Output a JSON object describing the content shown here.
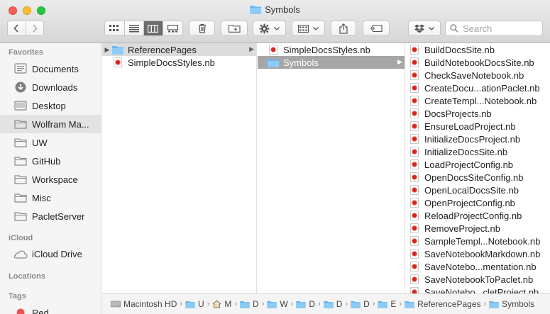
{
  "window": {
    "title": "Symbols"
  },
  "toolbar": {
    "search_placeholder": "Search",
    "view_modes": [
      "icon-view",
      "list-view",
      "column-view",
      "gallery-view"
    ],
    "active_view": "column-view"
  },
  "sidebar": {
    "sections": [
      {
        "header": "Favorites",
        "items": [
          {
            "label": "Documents",
            "icon": "documents-icon"
          },
          {
            "label": "Downloads",
            "icon": "downloads-icon"
          },
          {
            "label": "Desktop",
            "icon": "desktop-icon"
          },
          {
            "label": "Wolfram Ma...",
            "icon": "folder-icon",
            "selected": true
          },
          {
            "label": "UW",
            "icon": "folder-icon"
          },
          {
            "label": "GitHub",
            "icon": "folder-icon"
          },
          {
            "label": "Workspace",
            "icon": "folder-icon"
          },
          {
            "label": "Misc",
            "icon": "folder-icon"
          },
          {
            "label": "PacletServer",
            "icon": "folder-icon"
          }
        ]
      },
      {
        "header": "iCloud",
        "items": [
          {
            "label": "iCloud Drive",
            "icon": "cloud-icon"
          }
        ]
      },
      {
        "header": "Locations",
        "items": []
      },
      {
        "header": "Tags",
        "items": [
          {
            "label": "Red",
            "icon": "red-tag-icon"
          }
        ]
      }
    ]
  },
  "columns": {
    "col1": [
      {
        "label": "ReferencePages",
        "type": "folder",
        "selected": true
      },
      {
        "label": "SimpleDocsStyles.nb",
        "type": "notebook"
      }
    ],
    "col2": [
      {
        "label": "SimpleDocsStyles.nb",
        "type": "notebook"
      },
      {
        "label": "Symbols",
        "type": "folder",
        "selected": true
      }
    ],
    "col3": [
      "BuildDocsSite.nb",
      "BuildNotebookDocsSite.nb",
      "CheckSaveNotebook.nb",
      "CreateDocu...ationPaclet.nb",
      "CreateTempl...Notebook.nb",
      "DocsProjects.nb",
      "EnsureLoadProject.nb",
      "InitializeDocsProject.nb",
      "InitializeDocsSite.nb",
      "LoadProjectConfig.nb",
      "OpenDocsSiteConfig.nb",
      "OpenLocalDocsSite.nb",
      "OpenProjectConfig.nb",
      "ReloadProjectConfig.nb",
      "RemoveProject.nb",
      "SampleTempl...Notebook.nb",
      "SaveNotebookMarkdown.nb",
      "SaveNotebo...mentation.nb",
      "SaveNotebookToPaclet.nb",
      "SaveNotebo...cletProject.nb"
    ]
  },
  "pathbar": [
    {
      "label": "Macintosh HD",
      "icon": "disk-icon"
    },
    {
      "label": "U",
      "icon": "folder-icon"
    },
    {
      "label": "M",
      "icon": "home-icon"
    },
    {
      "label": "D",
      "icon": "folder-icon"
    },
    {
      "label": "W",
      "icon": "folder-icon"
    },
    {
      "label": "D",
      "icon": "folder-icon"
    },
    {
      "label": "D",
      "icon": "folder-icon"
    },
    {
      "label": "D",
      "icon": "folder-icon"
    },
    {
      "label": "E",
      "icon": "folder-icon"
    },
    {
      "label": "ReferencePages",
      "icon": "folder-icon"
    },
    {
      "label": "Symbols",
      "icon": "folder-icon"
    }
  ]
}
